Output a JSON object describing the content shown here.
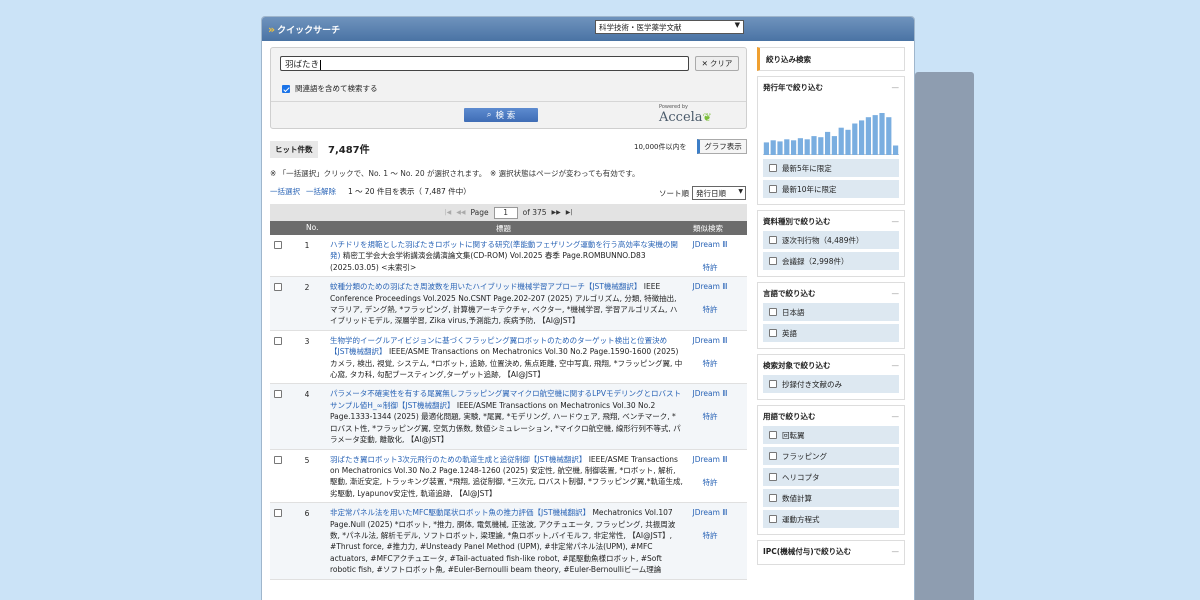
{
  "app": {
    "title": "クイックサーチ",
    "database": "科学技術・医学薬学文献"
  },
  "search": {
    "query": "羽ばたき",
    "clear_label": "クリア",
    "related_label": "関連語を含めて検索する",
    "related_checked": true,
    "submit_label": "検 索",
    "powered_by": "Powered by",
    "brand": "Accela"
  },
  "results_summary": {
    "hit_label": "ヒット件数",
    "hit_count": "7,487件",
    "graph_note": "10,000件以内を",
    "graph_button": "グラフ表示",
    "info": "※ 「一括選択」クリックで、No. 1 ～ No. 20 が選択されます。　※ 選択状態はページが変わっても有効です。",
    "select_all": "一括選択",
    "deselect_all": "一括解除",
    "range": "1 ～ 20 件目を表示（ 7,487 件中）",
    "sort_label": "ソート順",
    "sort_value": "発行日順"
  },
  "pager": {
    "page_label": "Page",
    "current": "1",
    "of": "of 375"
  },
  "table": {
    "headers": {
      "no": "No.",
      "title": "標題",
      "similar": "類似検索"
    },
    "rows": [
      {
        "no": "1",
        "title": "ハチドリを規範とした羽ばたきロボットに関する研究(準能動フェザリング運動を行う高効率な実機の開発)",
        "meta": " 精密工学会大会学術講演会講演論文集(CD-ROM) Vol.2025 春季 Page.ROMBUNNO.D83 (2025.03.05) <未索引>",
        "link1": "JDream Ⅲ",
        "link2": "特許"
      },
      {
        "no": "2",
        "title": "蚊種分類のための羽ばたき周波数を用いたハイブリッド機械学習アプローチ【JST機械翻訳】",
        "meta": " IEEE Conference Proceedings Vol.2025 No.CSNT Page.202-207 (2025) アルゴリズム, 分類, 特徴抽出, マラリア, デング熱, *フラッピング, 計算機アーキテクチャ, ベクター, *機械学習, 学習アルゴリズム, ハイブリッドモデル, 深層学習, Zika virus,予測能力, 疾病予防, 【AI@JST】",
        "link1": "JDream Ⅲ",
        "link2": "特許"
      },
      {
        "no": "3",
        "title": "生物学的イーグルアイビジョンに基づくフラッピング翼ロボットのためのターゲット検出と位置決め【JST機械翻訳】",
        "meta": " IEEE/ASME Transactions on Mechatronics Vol.30 No.2 Page.1590-1600 (2025) カメラ, 検出, 視覚, システム, *ロボット, 追跡, 位置決め, 焦点距離, 空中写真, 飛翔, *フラッピング翼, 中心窩, タカ科, 勾配ブースティング,ターゲット追跡, 【AI@JST】",
        "link1": "JDream Ⅲ",
        "link2": "特許"
      },
      {
        "no": "4",
        "title": "パラメータ不確実性を有する尾翼無しフラッピング翼マイクロ航空機に関するLPVモデリングとロバストサンプル値H_∞制御【JST機械翻訳】",
        "meta": " IEEE/ASME Transactions on Mechatronics Vol.30 No.2 Page.1333-1344 (2025) 最適化問題, 実験, *尾翼, *モデリング, ハードウェア, 飛翔, ベンチマーク, *ロバスト性, *フラッピング翼, 空気力係数, 数値シミュレーション, *マイクロ航空機, 線形行列不等式, パラメータ変動, 離散化, 【AI@JST】",
        "link1": "JDream Ⅲ",
        "link2": "特許"
      },
      {
        "no": "5",
        "title": "羽ばたき翼ロボット3次元飛行のための軌道生成と追従制御【JST機械翻訳】",
        "meta": " IEEE/ASME Transactions on Mechatronics Vol.30 No.2 Page.1248-1260 (2025) 安定性, 航空機, 制御装置, *ロボット, 解析, 駆動, 漸近安定, トラッキング装置, *飛翔, 追従制御, *三次元, ロバスト制御, *フラッピング翼,*軌道生成, 劣駆動, Lyapunov安定性, 軌道追跡, 【AI@JST】",
        "link1": "JDream Ⅲ",
        "link2": "特許"
      },
      {
        "no": "6",
        "title": "非定常パネル法を用いたMFC駆動尾状ロボット魚の推力評価【JST機械翻訳】",
        "meta": " Mechatronics Vol.107 Page.Null (2025) *ロボット, *推力, 胴体, 電気機械, 正弦波, アクチュエータ, フラッピング, 共振周波数, *パネル法, 解析モデル, ソフトロボット, 梁理論, *魚ロボット,バイモルフ, 非定常性, 【AI@JST】, #Thrust force, #推力力, #Unsteady Panel Method (UPM), #非定常パネル法(UPM), #MFC actuators, #MFCアクチュエータ, #Tail-actuated fish-like robot, #尾駆動魚様ロボット, #Soft robotic fish, #ソフトロボット魚, #Euler-Bernoulli beam theory, #Euler-Bernoulliビーム理論",
        "link1": "JDream Ⅲ",
        "link2": "特許"
      }
    ]
  },
  "sidebar": {
    "header": "絞り込み検索",
    "sections": [
      {
        "title": "発行年で絞り込む",
        "items": [
          "最新5年に限定",
          "最新10年に限定"
        ]
      },
      {
        "title": "資料種別で絞り込む",
        "items": [
          "逐次刊行物（4,489件）",
          "会議録（2,998件）"
        ]
      },
      {
        "title": "言語で絞り込む",
        "items": [
          "日本語",
          "英語"
        ]
      },
      {
        "title": "検索対象で絞り込む",
        "items": [
          "抄録付き文献のみ"
        ]
      },
      {
        "title": "用語で絞り込む",
        "items": [
          "回転翼",
          "フラッピング",
          "ヘリコプタ",
          "数値計算",
          "運動方程式"
        ]
      },
      {
        "title": "IPC(機械付与)で絞り込む",
        "items": []
      }
    ],
    "collapse_symbol": "—"
  },
  "chart_data": {
    "type": "bar",
    "values": [
      12,
      14,
      13,
      15,
      14,
      16,
      15,
      18,
      17,
      22,
      18,
      26,
      24,
      30,
      33,
      36,
      38,
      40,
      36,
      9
    ],
    "color": "#7aaee0",
    "title": "",
    "xlabel": "",
    "ylabel": ""
  }
}
